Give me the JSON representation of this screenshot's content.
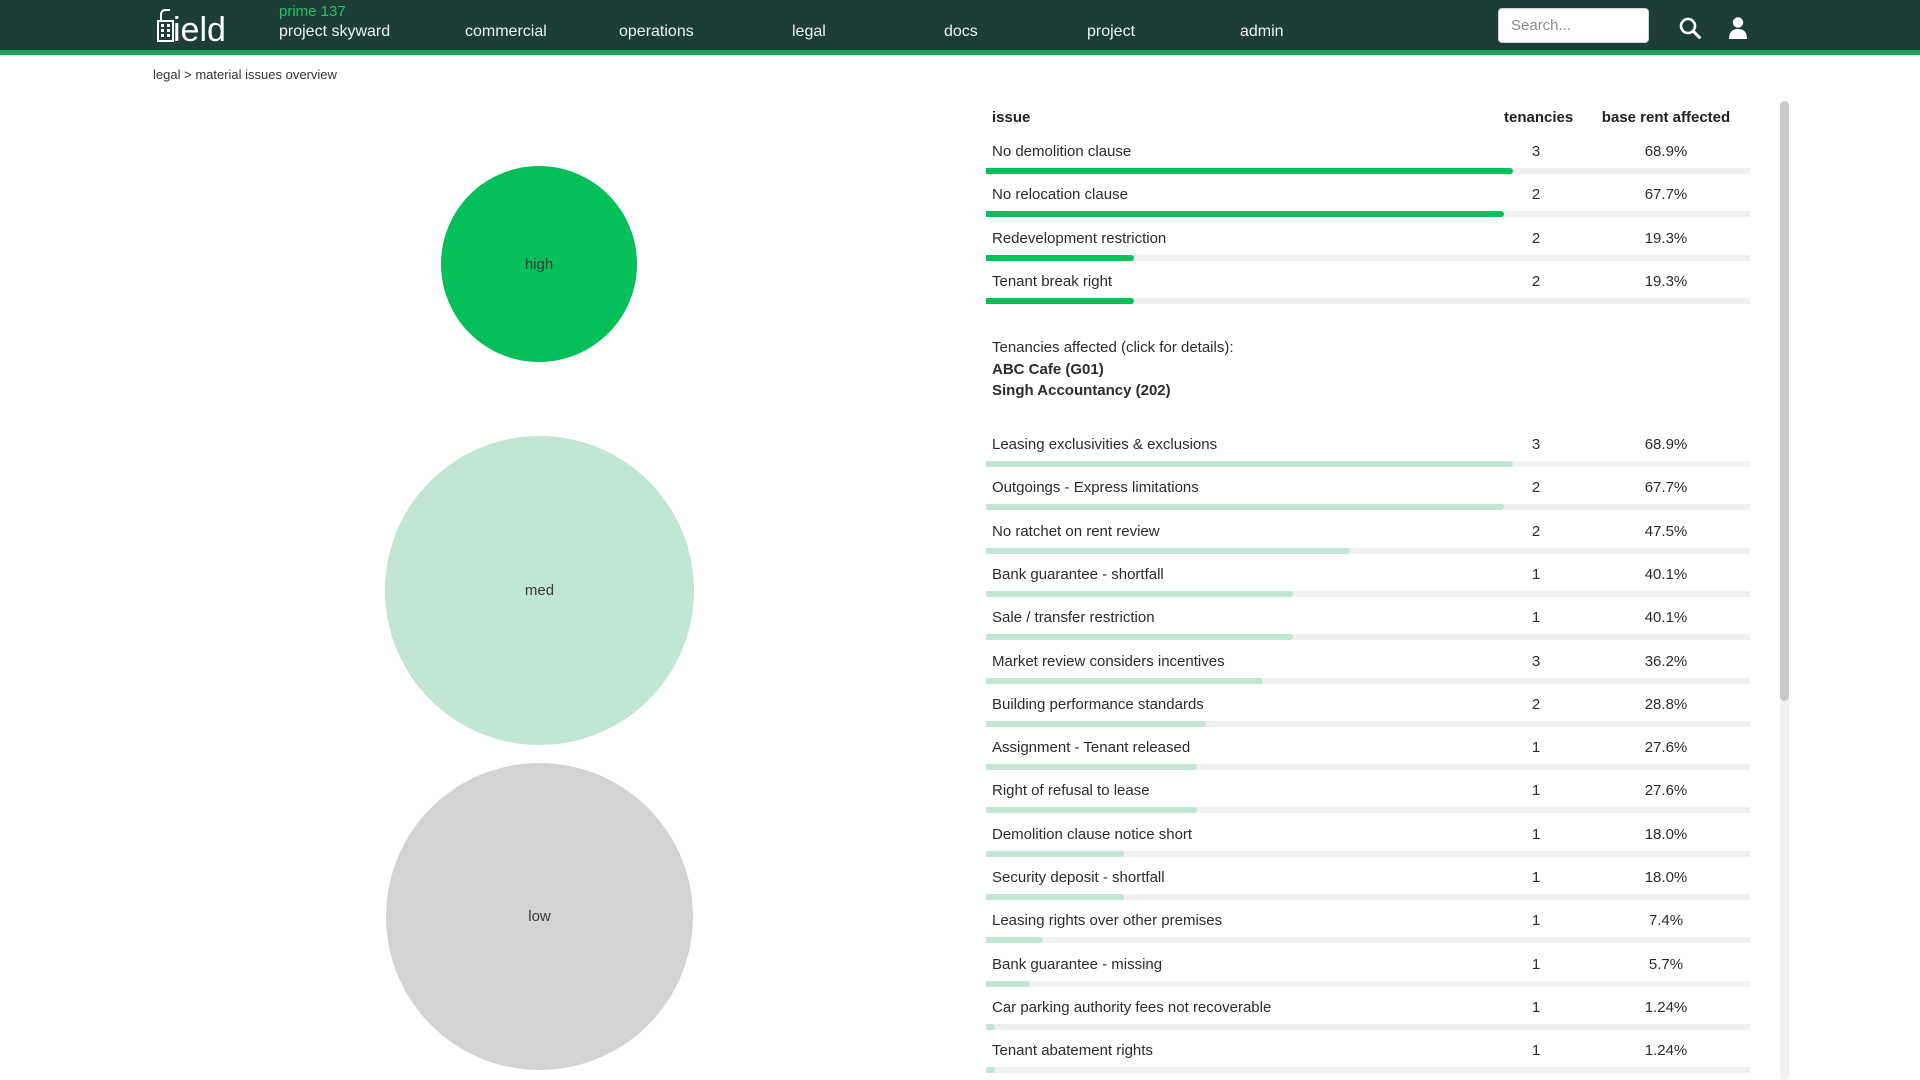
{
  "header": {
    "logo_text": "field",
    "project_code": "prime 137",
    "project_name": "project skyward",
    "nav": [
      "commercial",
      "operations",
      "legal",
      "docs",
      "project",
      "admin"
    ],
    "search_placeholder": "Search...",
    "colors": {
      "bar": "#1e3d37",
      "accent": "#1aa35b",
      "project_code": "#21c26a"
    }
  },
  "breadcrumb": {
    "section": "legal",
    "separator": ">",
    "page": "material issues overview"
  },
  "severity": [
    {
      "label": "high",
      "color": "#05bf5b"
    },
    {
      "label": "med",
      "color": "#c1e6d4"
    },
    {
      "label": "low",
      "color": "#d3d3d3"
    }
  ],
  "table": {
    "headers": {
      "issue": "issue",
      "tenancies": "tenancies",
      "rent": "base rent affected"
    },
    "high_issues": [
      {
        "name": "No demolition clause",
        "tenancies": "3",
        "pct": "68.9%",
        "value": 68.9
      },
      {
        "name": "No relocation clause",
        "tenancies": "2",
        "pct": "67.7%",
        "value": 67.7
      },
      {
        "name": "Redevelopment restriction",
        "tenancies": "2",
        "pct": "19.3%",
        "value": 19.3
      },
      {
        "name": "Tenant break right",
        "tenancies": "2",
        "pct": "19.3%",
        "value": 19.3
      }
    ],
    "tenancies_affected": {
      "label": "Tenancies affected (click for details):",
      "items": [
        "ABC Cafe (G01)",
        "Singh Accountancy (202)"
      ]
    },
    "med_issues": [
      {
        "name": "Leasing exclusivities & exclusions",
        "tenancies": "3",
        "pct": "68.9%",
        "value": 68.9
      },
      {
        "name": "Outgoings - Express limitations",
        "tenancies": "2",
        "pct": "67.7%",
        "value": 67.7
      },
      {
        "name": "No ratchet on rent review",
        "tenancies": "2",
        "pct": "47.5%",
        "value": 47.5
      },
      {
        "name": "Bank guarantee - shortfall",
        "tenancies": "1",
        "pct": "40.1%",
        "value": 40.1
      },
      {
        "name": "Sale / transfer restriction",
        "tenancies": "1",
        "pct": "40.1%",
        "value": 40.1
      },
      {
        "name": "Market review considers incentives",
        "tenancies": "3",
        "pct": "36.2%",
        "value": 36.2
      },
      {
        "name": "Building performance standards",
        "tenancies": "2",
        "pct": "28.8%",
        "value": 28.8
      },
      {
        "name": "Assignment - Tenant released",
        "tenancies": "1",
        "pct": "27.6%",
        "value": 27.6
      },
      {
        "name": "Right of refusal to lease",
        "tenancies": "1",
        "pct": "27.6%",
        "value": 27.6
      },
      {
        "name": "Demolition clause notice short",
        "tenancies": "1",
        "pct": "18.0%",
        "value": 18.0
      },
      {
        "name": "Security deposit - shortfall",
        "tenancies": "1",
        "pct": "18.0%",
        "value": 18.0
      },
      {
        "name": "Leasing rights over other premises",
        "tenancies": "1",
        "pct": "7.4%",
        "value": 7.4
      },
      {
        "name": "Bank guarantee - missing",
        "tenancies": "1",
        "pct": "5.7%",
        "value": 5.7
      },
      {
        "name": "Car parking authority fees not recoverable",
        "tenancies": "1",
        "pct": "1.24%",
        "value": 1.24
      },
      {
        "name": "Tenant abatement rights",
        "tenancies": "1",
        "pct": "1.24%",
        "value": 1.24
      }
    ]
  }
}
